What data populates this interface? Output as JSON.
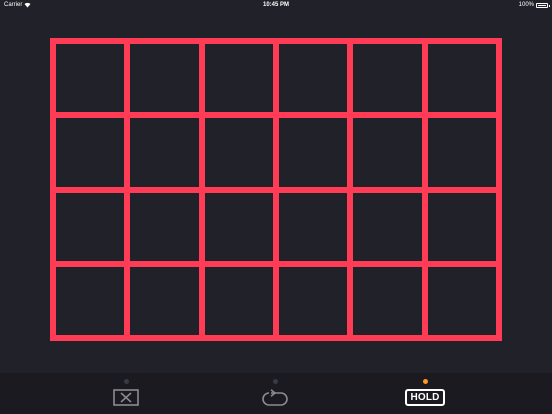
{
  "status_bar": {
    "carrier": "Carrier",
    "time": "10:45 PM",
    "battery": "100%",
    "icons": [
      "wifi-icon",
      "battery-icon"
    ]
  },
  "grid": {
    "rows": 4,
    "columns": 6
  },
  "toolbar": {
    "clear_icon": "clear-icon",
    "loop_icon": "loop-icon",
    "hold_label": "HOLD",
    "hold_active": true
  },
  "colors": {
    "background": "#212129",
    "grid_line": "#ff3b55",
    "toolbar_bg": "#1a1a20",
    "active_indicator": "#ff9a1f",
    "inactive_indicator": "#3a3a42",
    "icon_inactive": "#8a8a92"
  }
}
